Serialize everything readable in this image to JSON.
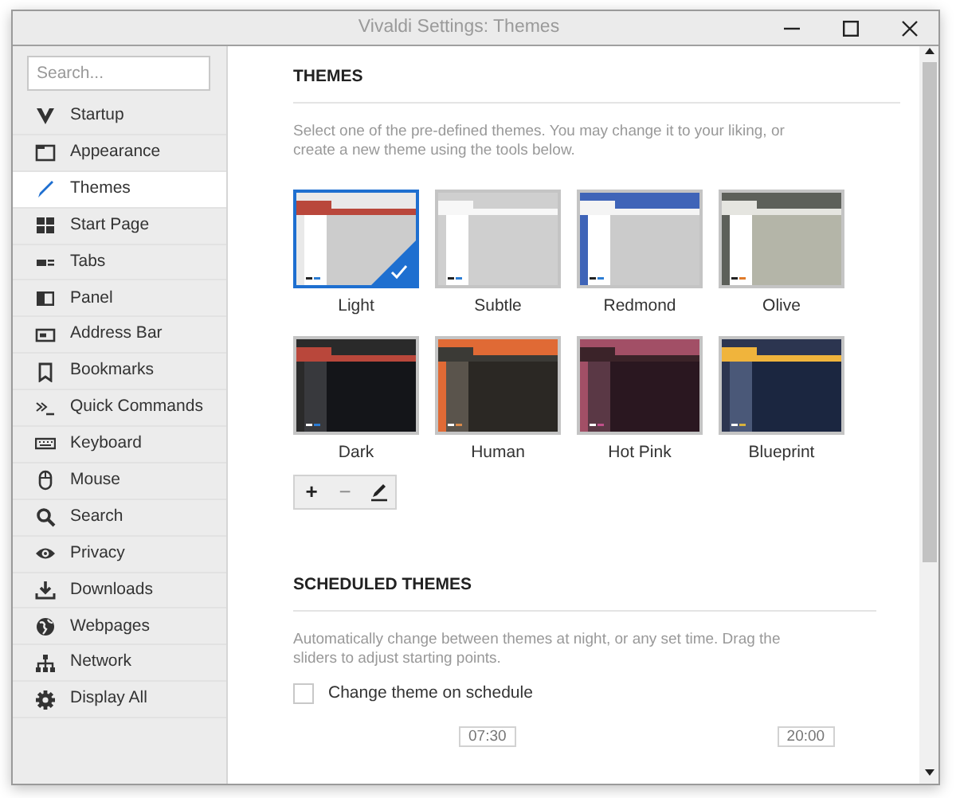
{
  "window": {
    "title": "Vivaldi Settings: Themes"
  },
  "sidebar": {
    "search": {
      "placeholder": "Search..."
    },
    "items": [
      {
        "label": "Startup",
        "selected": false
      },
      {
        "label": "Appearance",
        "selected": false
      },
      {
        "label": "Themes",
        "selected": true
      },
      {
        "label": "Start Page",
        "selected": false
      },
      {
        "label": "Tabs",
        "selected": false
      },
      {
        "label": "Panel",
        "selected": false
      },
      {
        "label": "Address Bar",
        "selected": false
      },
      {
        "label": "Bookmarks",
        "selected": false
      },
      {
        "label": "Quick Commands",
        "selected": false
      },
      {
        "label": "Keyboard",
        "selected": false
      },
      {
        "label": "Mouse",
        "selected": false
      },
      {
        "label": "Search",
        "selected": false
      },
      {
        "label": "Privacy",
        "selected": false
      },
      {
        "label": "Downloads",
        "selected": false
      },
      {
        "label": "Webpages",
        "selected": false
      },
      {
        "label": "Network",
        "selected": false
      },
      {
        "label": "Display All",
        "selected": false
      }
    ]
  },
  "themes_section": {
    "heading": "THEMES",
    "description": "Select one of the pre-defined themes. You may change it to your liking, or create a new theme using the tools below.",
    "themes": [
      {
        "name": "Light",
        "selected": true,
        "color": "#b9473b"
      },
      {
        "name": "Subtle",
        "selected": false,
        "color": "#cfcfcf"
      },
      {
        "name": "Redmond",
        "selected": false,
        "color": "#3f64b8"
      },
      {
        "name": "Olive",
        "selected": false,
        "color": "#5d605a"
      },
      {
        "name": "Dark",
        "selected": false,
        "color": "#b9473b"
      },
      {
        "name": "Human",
        "selected": false,
        "color": "#e06a35"
      },
      {
        "name": "Hot Pink",
        "selected": false,
        "color": "#a24f66"
      },
      {
        "name": "Blueprint",
        "selected": false,
        "color": "#f0b43c"
      }
    ],
    "tools": [
      {
        "kind": "add",
        "label": "+",
        "disabled": false
      },
      {
        "kind": "remove",
        "label": "−",
        "disabled": true
      },
      {
        "kind": "edit",
        "disabled": false
      }
    ]
  },
  "scheduled_section": {
    "heading": "SCHEDULED THEMES",
    "description": "Automatically change between themes at night, or any set time. Drag the sliders to adjust starting points.",
    "checkbox": {
      "label": "Change theme on schedule",
      "checked": false
    },
    "times": [
      "07:30",
      "20:00"
    ]
  }
}
